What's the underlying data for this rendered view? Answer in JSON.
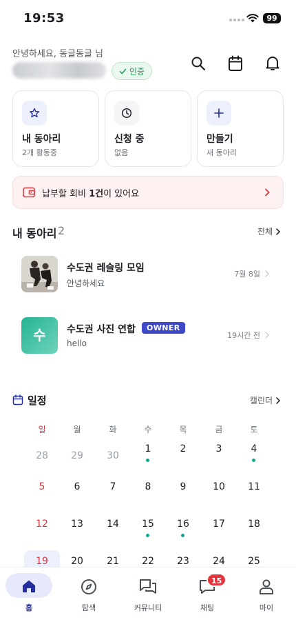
{
  "status_bar": {
    "time": "19:53",
    "battery": "99"
  },
  "header": {
    "greeting": "안녕하세요, 동글동글 님",
    "verified_label": "인증"
  },
  "quick_cards": [
    {
      "title": "내 동아리",
      "sub": "2개 활동중",
      "icon": "star-icon"
    },
    {
      "title": "신청 중",
      "sub": "없음",
      "icon": "clock-icon"
    },
    {
      "title": "만들기",
      "sub": "새 동아리",
      "icon": "plus-icon"
    }
  ],
  "dues_banner": {
    "prefix": "납부할 회비 ",
    "bold": "1건",
    "suffix": "이 있어요"
  },
  "my_clubs": {
    "title": "내 동아리",
    "count": "2",
    "see_all": "전체",
    "items": [
      {
        "name": "수도권 레슬링 모임",
        "message": "안녕하세요",
        "time": "7월 8일"
      },
      {
        "name": "수도권 사진 연합",
        "badge": "OWNER",
        "message": "hello",
        "time": "19시간 전",
        "avatar_letter": "수"
      }
    ]
  },
  "schedule": {
    "title": "일정",
    "calendar_link": "캘린더",
    "weekdays": [
      "일",
      "월",
      "화",
      "수",
      "목",
      "금",
      "토"
    ],
    "weeks": [
      [
        "28",
        "29",
        "30",
        "1",
        "2",
        "3",
        "4"
      ],
      [
        "5",
        "6",
        "7",
        "8",
        "9",
        "10",
        "11"
      ],
      [
        "12",
        "13",
        "14",
        "15",
        "16",
        "17",
        "18"
      ],
      [
        "19",
        "20",
        "21",
        "22",
        "23",
        "24",
        "25"
      ]
    ]
  },
  "tab_bar": {
    "tabs": [
      "홈",
      "탐색",
      "커뮤니티",
      "채팅",
      "마이"
    ],
    "chat_badge": "15"
  },
  "colors": {
    "accent": "#262fa0",
    "event_dot": "#12a58e",
    "sunday": "#d9363e",
    "badge": "#3f48c8"
  }
}
